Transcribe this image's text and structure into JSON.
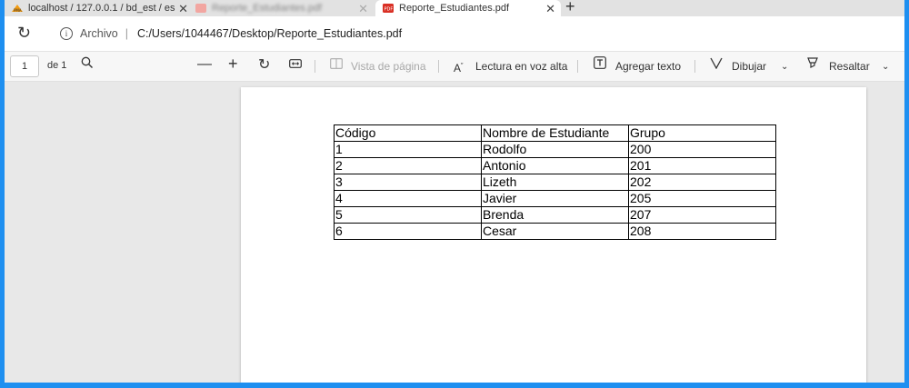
{
  "browser": {
    "tabs": [
      {
        "title": "localhost / 127.0.0.1 / bd_est / es",
        "state": "partial"
      },
      {
        "title": "Reporte_Estudiantes.pdf",
        "state": "blurred"
      },
      {
        "title": "Reporte_Estudiantes.pdf",
        "state": "active"
      }
    ],
    "new_tab_label": "+",
    "close_label": "✕",
    "address": {
      "origin_label": "Archivo",
      "separator": "|",
      "url": "C:/Users/1044467/Desktop/Reporte_Estudiantes.pdf"
    }
  },
  "pdf_toolbar": {
    "page_number": "1",
    "page_total": "de 1",
    "page_view_label": "Vista de página",
    "read_aloud_label": "Lectura en voz alta",
    "add_text_label": "Agregar texto",
    "draw_label": "Dibujar",
    "highlight_label": "Resaltar"
  },
  "report": {
    "headers": [
      "Código",
      "Nombre de Estudiante",
      "Grupo"
    ],
    "rows": [
      [
        "1",
        "Rodolfo",
        "200"
      ],
      [
        "2",
        "Antonio",
        "201"
      ],
      [
        "3",
        "Lizeth",
        "202"
      ],
      [
        "4",
        "Javier",
        "205"
      ],
      [
        "5",
        "Brenda",
        "207"
      ],
      [
        "6",
        "Cesar",
        "208"
      ]
    ]
  },
  "colors": {
    "outer_border": "#1e8ff0",
    "pdf_favicon": "#d93025"
  }
}
